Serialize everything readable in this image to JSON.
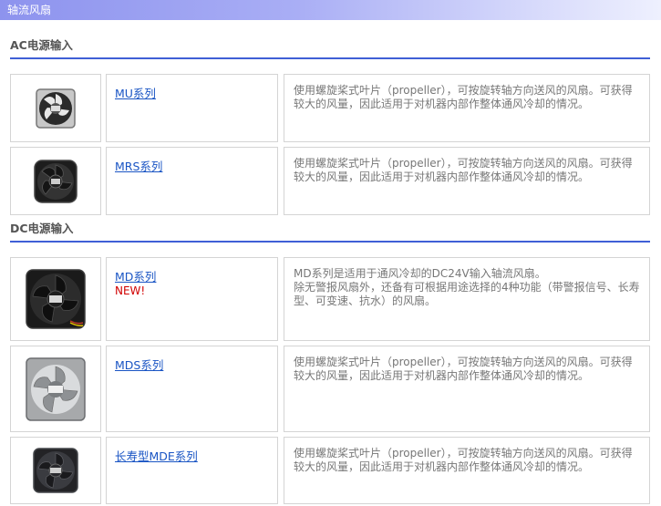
{
  "header": {
    "title": "轴流风扇"
  },
  "sections": [
    {
      "title": "AC电源输入",
      "products": [
        {
          "name": "MU系列",
          "badge": "",
          "icon": "fan-icon",
          "description": [
            "使用螺旋桨式叶片（propeller），可按旋转轴方向送风的风扇。可获得较大的风量，因此适用于对机器内部作整体通风冷却的情况。"
          ]
        },
        {
          "name": "MRS系列",
          "badge": "",
          "icon": "fan-icon",
          "description": [
            "使用螺旋桨式叶片（propeller），可按旋转轴方向送风的风扇。可获得较大的风量，因此适用于对机器内部作整体通风冷却的情况。"
          ]
        }
      ]
    },
    {
      "title": "DC电源输入",
      "products": [
        {
          "name": "MD系列",
          "badge": "NEW!",
          "icon": "fan-icon",
          "description": [
            "MD系列是适用于通风冷却的DC24V输入轴流风扇。",
            "除无警报风扇外，还备有可根据用途选择的4种功能（带警报信号、长寿型、可变速、抗水）的风扇。"
          ]
        },
        {
          "name": "MDS系列",
          "badge": "",
          "icon": "fan-icon",
          "description": [
            "使用螺旋桨式叶片（propeller），可按旋转轴方向送风的风扇。可获得较大的风量，因此适用于对机器内部作整体通风冷却的情况。"
          ]
        },
        {
          "name": "长寿型MDE系列",
          "badge": "",
          "icon": "fan-icon",
          "description": [
            "使用螺旋桨式叶片（propeller），可按旋转轴方向送风的风扇。可获得较大的风量，因此适用于对机器内部作整体通风冷却的情况。"
          ]
        }
      ]
    }
  ]
}
